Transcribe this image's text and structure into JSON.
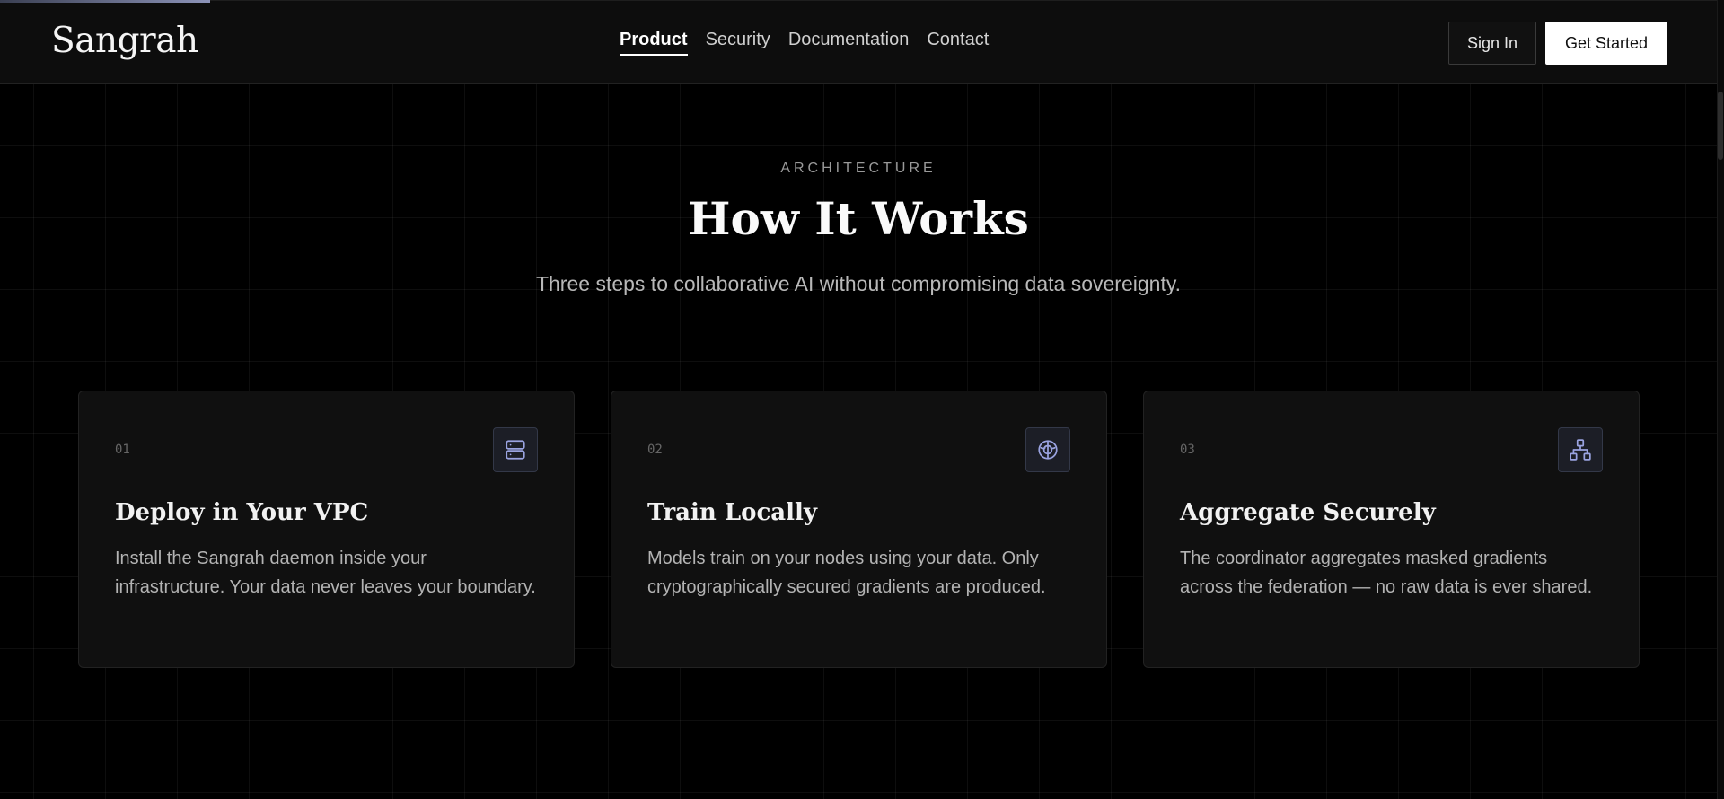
{
  "header": {
    "logo": "Sangrah",
    "nav": [
      {
        "label": "Product",
        "active": true
      },
      {
        "label": "Security",
        "active": false
      },
      {
        "label": "Documentation",
        "active": false
      },
      {
        "label": "Contact",
        "active": false
      }
    ],
    "sign_in_label": "Sign In",
    "get_started_label": "Get Started"
  },
  "section": {
    "eyebrow": "ARCHITECTURE",
    "title": "How It Works",
    "subtitle": "Three steps to collaborative AI without compromising data sovereignty."
  },
  "cards": [
    {
      "number": "01",
      "icon": "server-icon",
      "title": "Deploy in Your VPC",
      "description": "Install the Sangrah daemon inside your infrastructure. Your data never leaves your boundary."
    },
    {
      "number": "02",
      "icon": "brain-icon",
      "title": "Train Locally",
      "description": "Models train on your nodes using your data. Only cryptographically secured gradients are produced."
    },
    {
      "number": "03",
      "icon": "network-icon",
      "title": "Aggregate Securely",
      "description": "The coordinator aggregates masked gradients across the federation — no raw data is ever shared."
    }
  ],
  "colors": {
    "background": "#000000",
    "header_bg": "#0d0d0d",
    "card_bg": "#101010",
    "icon_accent": "#9aa3e0"
  }
}
